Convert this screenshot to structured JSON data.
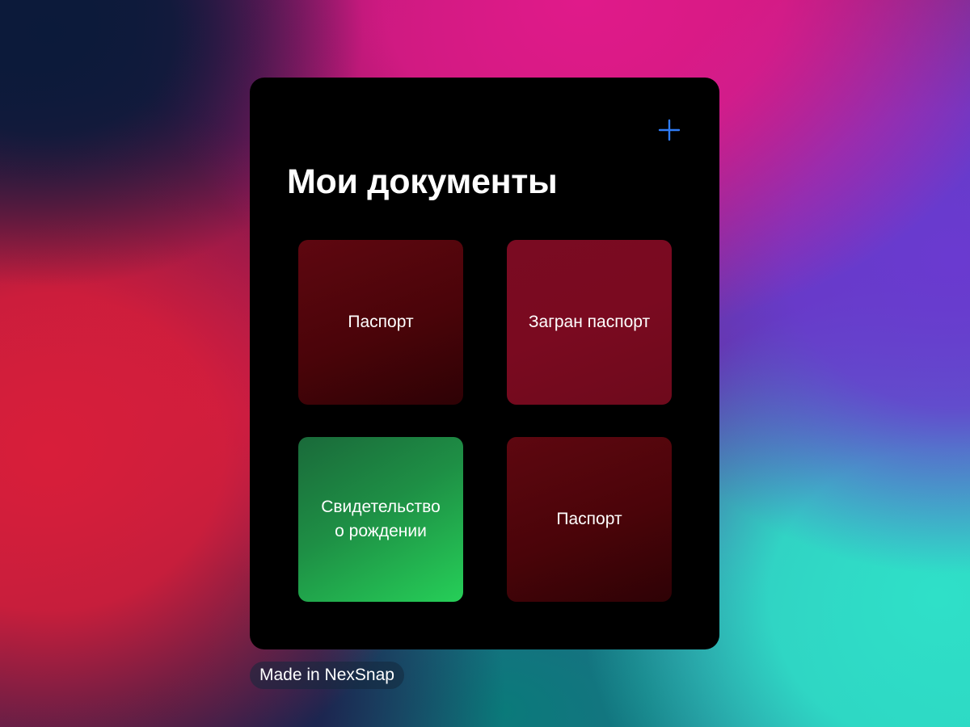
{
  "screen": {
    "title": "Мои документы",
    "add_icon": "plus-icon",
    "accent_color": "#2f7cf6",
    "documents": [
      {
        "label": "Паспорт",
        "color": "#4a0409"
      },
      {
        "label": "Загран паспорт",
        "color": "#7a0a20"
      },
      {
        "label": "Свидетельство\nо рождении",
        "color": "#1e8f45"
      },
      {
        "label": "Паспорт",
        "color": "#4a0409"
      }
    ]
  },
  "watermark": {
    "label": "Made in NexSnap"
  }
}
